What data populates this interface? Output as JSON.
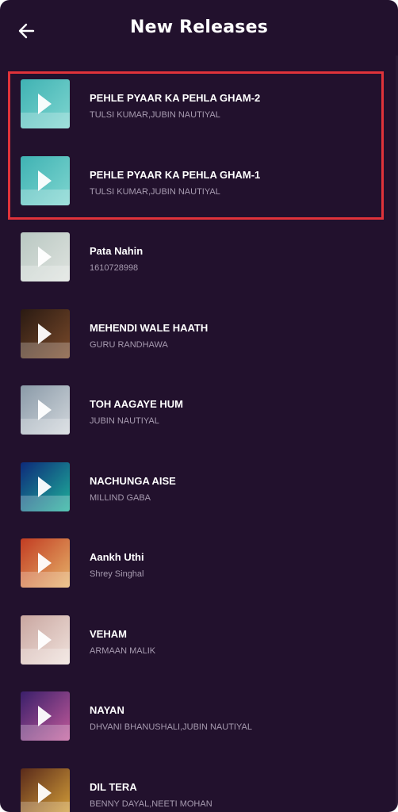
{
  "header": {
    "title": "New Releases"
  },
  "highlight_color": "#e0333a",
  "songs": [
    {
      "title": "PEHLE PYAAR KA PEHLA GHAM-2",
      "artist": "TULSI KUMAR,JUBIN NAUTIYAL",
      "thumb_color_a": "#3fb2b3",
      "thumb_color_b": "#7fd6d0"
    },
    {
      "title": "PEHLE PYAAR KA PEHLA GHAM-1",
      "artist": "TULSI KUMAR,JUBIN NAUTIYAL",
      "thumb_color_a": "#3fb2b3",
      "thumb_color_b": "#7fd6d0"
    },
    {
      "title": "Pata Nahin",
      "artist": "1610728998",
      "thumb_color_a": "#b9c8c2",
      "thumb_color_b": "#dfe3df"
    },
    {
      "title": "MEHENDI WALE HAATH",
      "artist": "GURU RANDHAWA",
      "thumb_color_a": "#2a1a12",
      "thumb_color_b": "#7a4a2a"
    },
    {
      "title": "TOH AAGAYE HUM",
      "artist": "JUBIN NAUTIYAL",
      "thumb_color_a": "#8a9aa8",
      "thumb_color_b": "#d2d7dc"
    },
    {
      "title": "NACHUNGA AISE",
      "artist": "MILLIND GABA",
      "thumb_color_a": "#0d2a7a",
      "thumb_color_b": "#1fb29a"
    },
    {
      "title": "Aankh Uthi",
      "artist": "Shrey Singhal",
      "thumb_color_a": "#c23c22",
      "thumb_color_b": "#e6b36a"
    },
    {
      "title": "VEHAM",
      "artist": "ARMAAN MALIK",
      "thumb_color_a": "#c9a6a0",
      "thumb_color_b": "#f0e2dc"
    },
    {
      "title": "NAYAN",
      "artist": "DHVANI BHANUSHALI,JUBIN NAUTIYAL",
      "thumb_color_a": "#3a1f6a",
      "thumb_color_b": "#c25a9a"
    },
    {
      "title": "DIL TERA",
      "artist": "BENNY DAYAL,NEETI MOHAN",
      "thumb_color_a": "#5a2a1a",
      "thumb_color_b": "#d7a23a"
    }
  ]
}
